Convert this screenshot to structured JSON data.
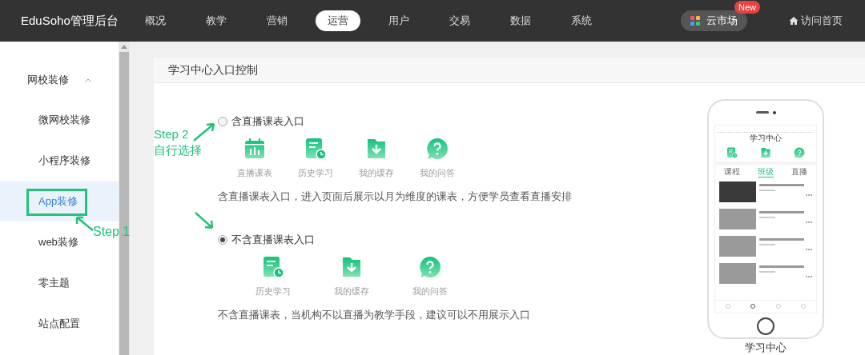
{
  "topbar": {
    "brand": "EduSoho管理后台",
    "nav": [
      {
        "label": "概况",
        "selected": false
      },
      {
        "label": "教学",
        "selected": false
      },
      {
        "label": "营销",
        "selected": false
      },
      {
        "label": "运营",
        "selected": true
      },
      {
        "label": "用户",
        "selected": false
      },
      {
        "label": "交易",
        "selected": false
      },
      {
        "label": "数据",
        "selected": false
      },
      {
        "label": "系统",
        "selected": false
      }
    ],
    "market": {
      "label": "云市场",
      "badge": "New"
    },
    "home_link": "访问首页"
  },
  "sidebar": {
    "group": {
      "label": "网校装修",
      "expanded": true
    },
    "items": [
      {
        "label": "微网校装修",
        "selected": false
      },
      {
        "label": "小程序装修",
        "selected": false
      },
      {
        "label": "App装修",
        "selected": true
      },
      {
        "label": "web装修",
        "selected": false
      },
      {
        "label": "零主题",
        "selected": false
      },
      {
        "label": "站点配置",
        "selected": false
      }
    ]
  },
  "panel": {
    "title": "学习中心入口控制",
    "options": [
      {
        "label": "含直播课表入口",
        "selected": false,
        "entries": [
          {
            "kind": "calendar",
            "label": "直播课表"
          },
          {
            "kind": "history",
            "label": "历史学习"
          },
          {
            "kind": "download",
            "label": "我的缓存"
          },
          {
            "kind": "question",
            "label": "我的问答"
          }
        ],
        "description": "含直播课表入口，进入页面后展示以月为维度的课表，方便学员查看直播安排"
      },
      {
        "label": "不含直播课表入口",
        "selected": true,
        "entries": [
          {
            "kind": "history",
            "label": "历史学习"
          },
          {
            "kind": "download",
            "label": "我的缓存"
          },
          {
            "kind": "question",
            "label": "我的问答"
          }
        ],
        "description": "不含直播课表，当机构不以直播为教学手段，建议可以不用展示入口"
      }
    ]
  },
  "preview": {
    "screen_title": "学习中心",
    "tabs": [
      {
        "label": "课程",
        "selected": false
      },
      {
        "label": "班级",
        "selected": true
      },
      {
        "label": "直播",
        "selected": false
      }
    ],
    "caption": "学习中心"
  },
  "annotations": {
    "step_1": "Step 1",
    "step_2": [
      "Step 2",
      "自行选择"
    ]
  }
}
